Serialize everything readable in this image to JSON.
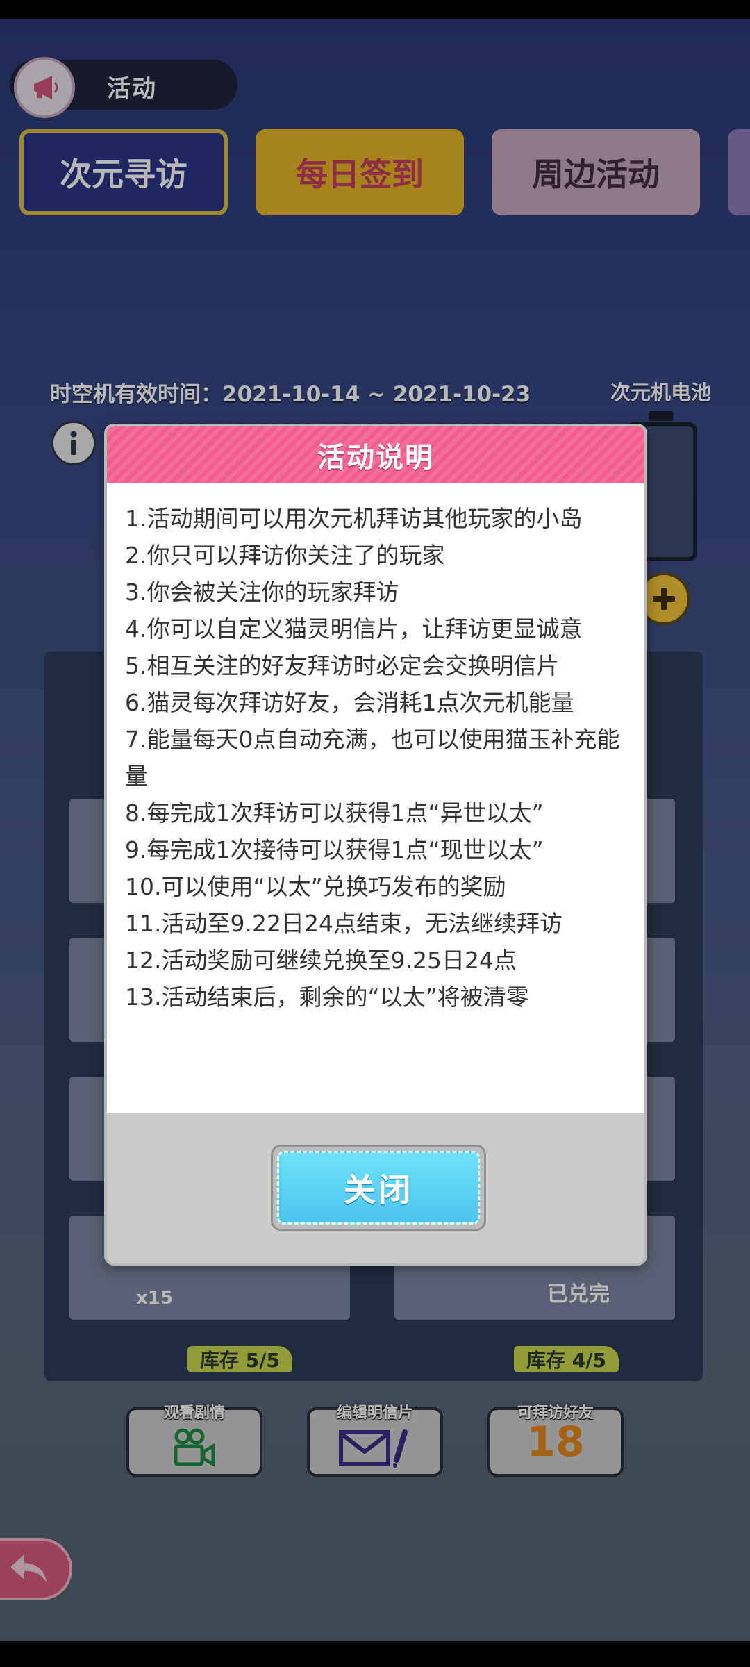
{
  "header": {
    "title": "活动"
  },
  "banners": [
    {
      "label": "次元寻访"
    },
    {
      "label": "每日签到"
    },
    {
      "label": "周边活动"
    }
  ],
  "validity": "时空机有效时间：2021-10-14 ~ 2021-10-23",
  "battery_label": "次元机电池",
  "inventory": {
    "stock_left": "库存 5/5",
    "stock_right": "库存 4/5",
    "count": "x15",
    "status": "已兑完"
  },
  "actions": [
    {
      "label": "观看剧情",
      "icon": "video-camera-icon"
    },
    {
      "label": "编辑明信片",
      "icon": "mail-edit-icon"
    },
    {
      "label": "可拜访好友",
      "value": "18"
    }
  ],
  "modal": {
    "title": "活动说明",
    "rules": [
      "1.活动期间可以用次元机拜访其他玩家的小岛",
      "2.你只可以拜访你关注了的玩家",
      "3.你会被关注你的玩家拜访",
      "4.你可以自定义猫灵明信片，让拜访更显诚意",
      "5.相互关注的好友拜访时必定会交换明信片",
      "6.猫灵每次拜访好友，会消耗1点次元机能量",
      "7.能量每天0点自动充满，也可以使用猫玉补充能量",
      "8.每完成1次拜访可以获得1点“异世以太”",
      "9.每完成1次接待可以获得1点“现世以太”",
      "10.可以使用“以太”兑换巧发布的奖励",
      "11.活动至9.22日24点结束，无法继续拜访",
      "12.活动奖励可继续兑换至9.25日24点",
      "13.活动结束后，剩余的“以太”将被清零"
    ],
    "close_label": "关闭"
  }
}
